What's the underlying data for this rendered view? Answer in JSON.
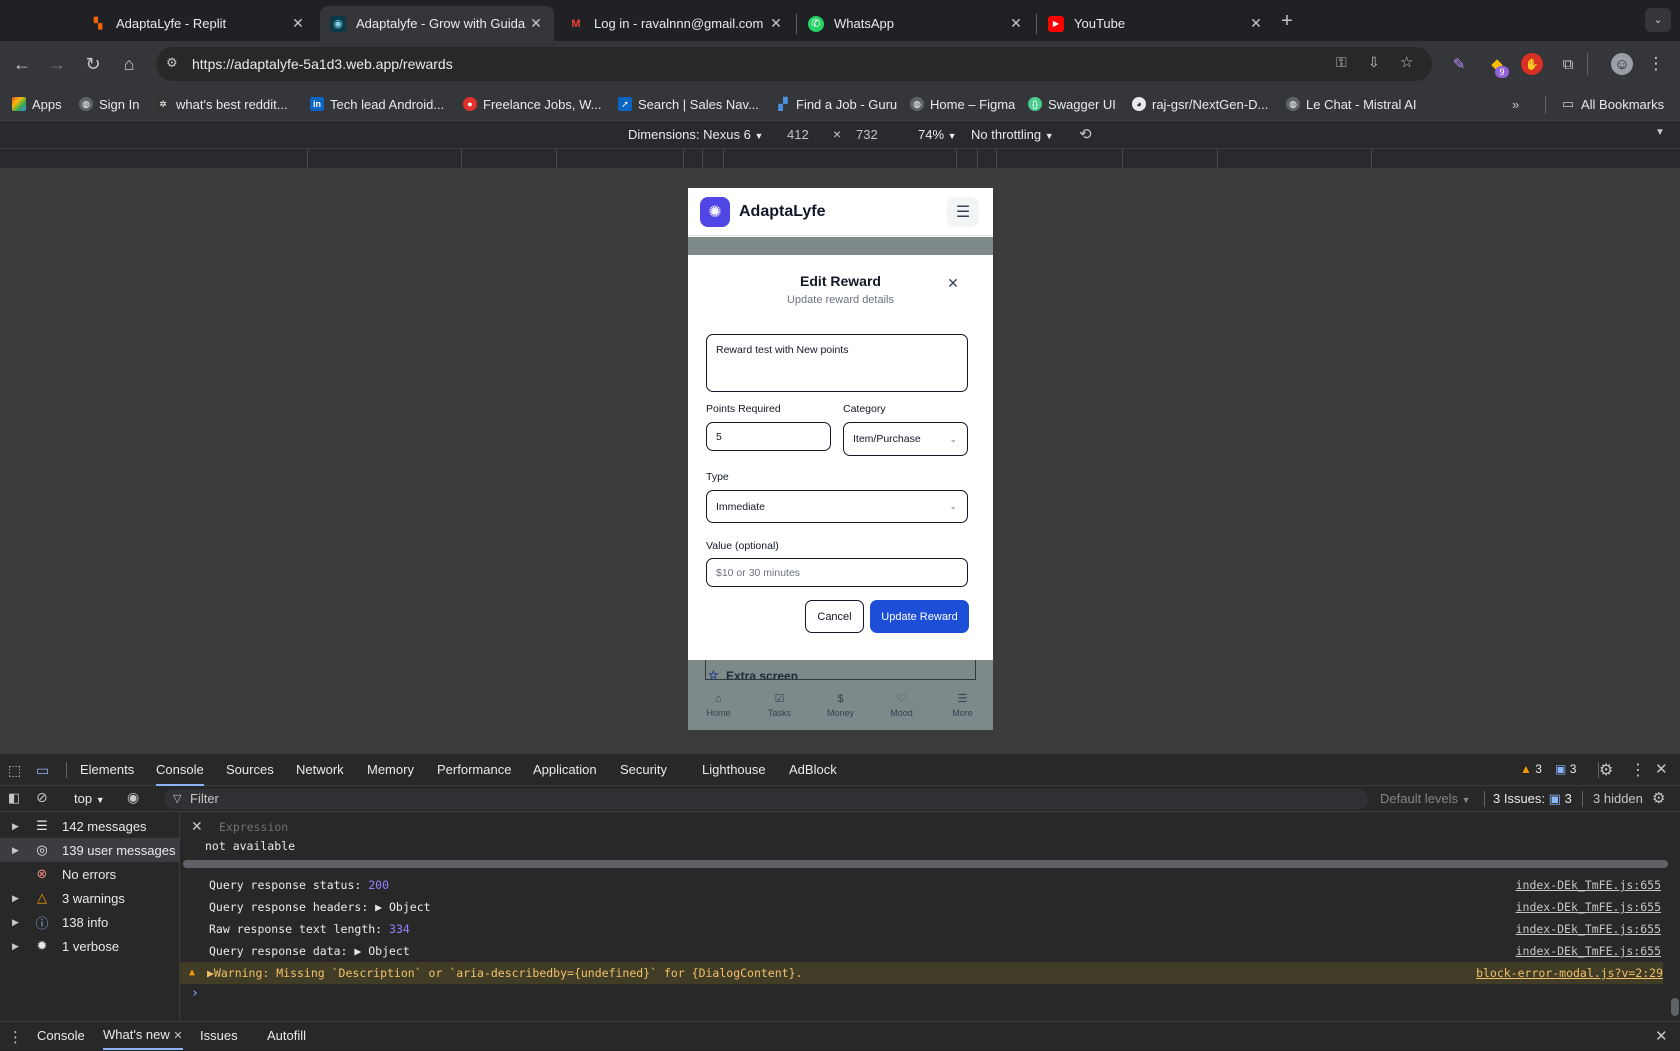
{
  "browser": {
    "tabs": [
      {
        "title": "AdaptaLyfe - Replit",
        "icon": "replit-icon"
      },
      {
        "title": "Adaptalyfe - Grow with Guida",
        "icon": "adaptalyfe-icon"
      },
      {
        "title": "Log in - ravalnnn@gmail.com",
        "icon": "gmail-icon"
      },
      {
        "title": "WhatsApp",
        "icon": "whatsapp-icon"
      },
      {
        "title": "YouTube",
        "icon": "youtube-icon"
      }
    ],
    "url": "https://adaptalyfe-5a1d3.web.app/rewards",
    "extension_badge": "9",
    "bookmarks": [
      "Apps",
      "Sign In",
      "what's best reddit...",
      "Tech lead Android...",
      "Freelance Jobs, W...",
      "Search | Sales Nav...",
      "Find a Job - Guru",
      "Home – Figma",
      "Swagger UI",
      "raj-gsr/NextGen-D...",
      "Le Chat - Mistral AI"
    ],
    "all_bookmarks": "All Bookmarks"
  },
  "device_toolbar": {
    "dimensions": "Dimensions: Nexus 6",
    "width": "412",
    "times": "×",
    "height": "732",
    "zoom": "74%",
    "throttling": "No throttling"
  },
  "app": {
    "title": "AdaptaLyfe",
    "dialog": {
      "title": "Edit Reward",
      "subtitle": "Update reward details",
      "description_value": "Reward test with New points",
      "points_label": "Points Required",
      "points_value": "5",
      "category_label": "Category",
      "category_value": "Item/Purchase",
      "type_label": "Type",
      "type_value": "Immediate",
      "value_label": "Value (optional)",
      "value_placeholder": "$10 or 30 minutes",
      "cancel": "Cancel",
      "update": "Update Reward"
    },
    "behind_card_text": "Extra screen",
    "bottom_nav": [
      {
        "label": "Home",
        "icon": "home-icon"
      },
      {
        "label": "Tasks",
        "icon": "tasks-icon"
      },
      {
        "label": "Money",
        "icon": "dollar-icon"
      },
      {
        "label": "Mood",
        "icon": "heart-icon"
      },
      {
        "label": "More",
        "icon": "menu-icon"
      }
    ]
  },
  "devtools": {
    "tabs": [
      "Elements",
      "Console",
      "Sources",
      "Network",
      "Memory",
      "Performance",
      "Application",
      "Security",
      "Lighthouse",
      "AdBlock"
    ],
    "warning_count": "3",
    "issue_count": "3",
    "context": "top",
    "filter_placeholder": "Filter",
    "default_levels": "Default levels",
    "issues_label": "3 Issues:",
    "issues_badge": "3",
    "hidden": "3 hidden",
    "sidebar": [
      "142 messages",
      "139 user messages",
      "No errors",
      "3 warnings",
      "138 info",
      "1 verbose"
    ],
    "expression_placeholder": "Expression",
    "expression_value": "not available",
    "logs": [
      {
        "text": "Query response status: ",
        "num": "200",
        "src": "index-DEk_TmFE.js:655"
      },
      {
        "text": "Query response headers: ▶ Object",
        "num": "",
        "src": "index-DEk_TmFE.js:655"
      },
      {
        "text": "Raw response text length: ",
        "num": "334",
        "src": "index-DEk_TmFE.js:655"
      },
      {
        "text": "Query response data: ▶ Object",
        "num": "",
        "src": "index-DEk_TmFE.js:655"
      }
    ],
    "warning_text": "▶Warning: Missing `Description` or `aria-describedby={undefined}` for {DialogContent}.",
    "warning_src": "block-error-modal.js?v=2:29",
    "drawer_tabs": [
      "Console",
      "What's new",
      "Issues",
      "Autofill"
    ]
  }
}
